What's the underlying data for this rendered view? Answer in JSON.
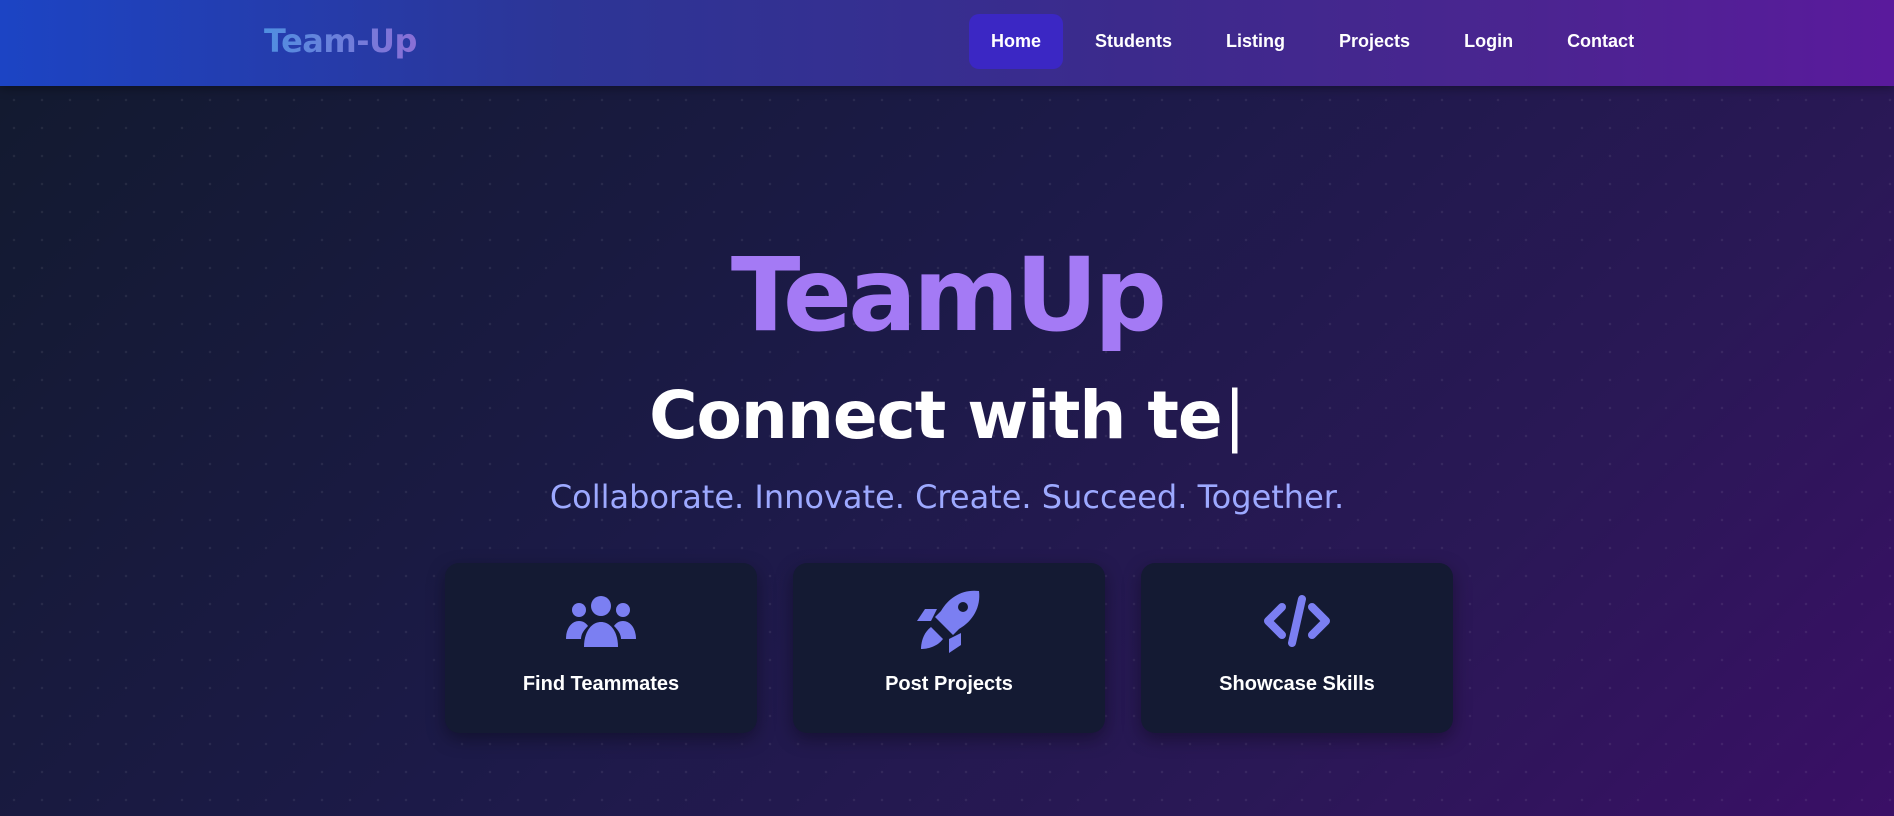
{
  "nav": {
    "logo": "Team-Up",
    "links": [
      {
        "label": "Home",
        "active": true
      },
      {
        "label": "Students",
        "active": false
      },
      {
        "label": "Listing",
        "active": false
      },
      {
        "label": "Projects",
        "active": false
      },
      {
        "label": "Login",
        "active": false
      },
      {
        "label": "Contact",
        "active": false
      }
    ]
  },
  "hero": {
    "title": "TeamUp",
    "typing_text": "Connect with te",
    "cursor": "|",
    "tagline": "Collaborate. Innovate. Create. Succeed. Together."
  },
  "features": [
    {
      "label": "Find Teammates",
      "icon": "users-icon"
    },
    {
      "label": "Post Projects",
      "icon": "rocket-icon"
    },
    {
      "label": "Showcase Skills",
      "icon": "code-icon"
    }
  ],
  "colors": {
    "accent": "#a47af5",
    "icon": "#7b7ff2",
    "tagline": "#9da9ff",
    "nav_active": "#3b27c4",
    "card_bg": "#141a33"
  }
}
